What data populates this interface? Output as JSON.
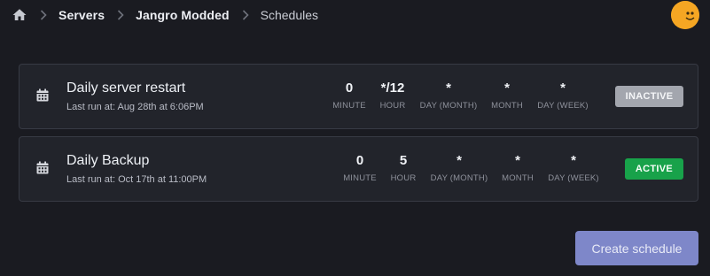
{
  "breadcrumb": {
    "home_icon": "home-icon",
    "items": [
      "Servers",
      "Jangro Modded"
    ],
    "current": "Schedules"
  },
  "avatar": {
    "icon": "smiley-face-avatar",
    "color": "#f5a623"
  },
  "cron_labels": [
    "MINUTE",
    "HOUR",
    "DAY (MONTH)",
    "MONTH",
    "DAY (WEEK)"
  ],
  "schedules": [
    {
      "name": "Daily server restart",
      "last_run": "Last run at: Aug 28th at 6:06PM",
      "cron": [
        "0",
        "*/12",
        "*",
        "*",
        "*"
      ],
      "status": "INACTIVE",
      "status_color": "#a3a6ae"
    },
    {
      "name": "Daily Backup",
      "last_run": "Last run at: Oct 17th at 11:00PM",
      "cron": [
        "0",
        "5",
        "*",
        "*",
        "*"
      ],
      "status": "ACTIVE",
      "status_color": "#18a24a"
    }
  ],
  "actions": {
    "create_label": "Create schedule",
    "create_color": "#7e87c9"
  },
  "theme": {
    "background": "#1a1b21",
    "card": "#22242b",
    "border": "#373a44"
  }
}
